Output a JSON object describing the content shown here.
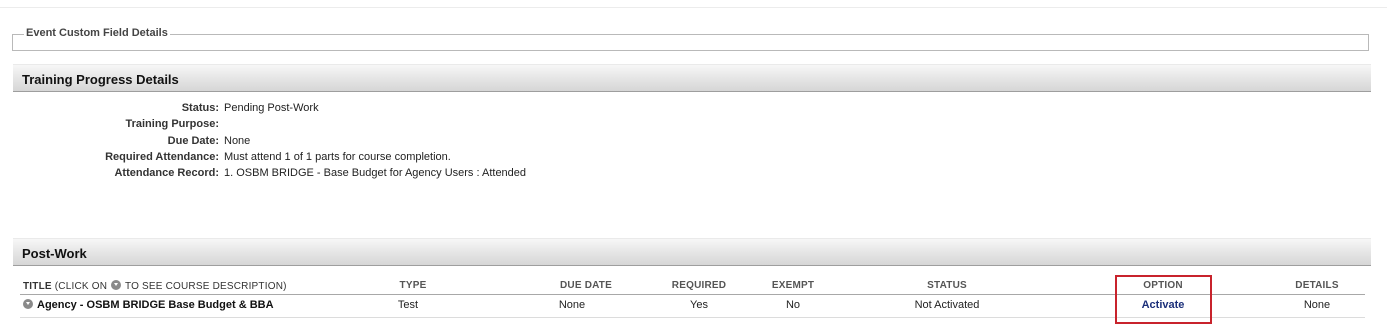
{
  "event_fields": {
    "legend": "Event Custom Field Details"
  },
  "training_progress": {
    "header": "Training Progress Details",
    "rows": [
      {
        "label": "Status:",
        "value": "Pending Post-Work"
      },
      {
        "label": "Training Purpose:",
        "value": ""
      },
      {
        "label": "Due Date:",
        "value": "None"
      },
      {
        "label": "Required Attendance:",
        "value": "Must attend 1 of 1 parts for course completion."
      },
      {
        "label": "Attendance Record:",
        "value": "1. OSBM BRIDGE - Base Budget for Agency Users : Attended"
      }
    ]
  },
  "post_work": {
    "header": "Post-Work",
    "columns": {
      "title_prefix": "TITLE",
      "title_hint_before": "(CLICK ON",
      "title_hint_after": "TO SEE COURSE DESCRIPTION)",
      "type": "TYPE",
      "due_date": "DUE DATE",
      "required": "REQUIRED",
      "exempt": "EXEMPT",
      "status": "STATUS",
      "option": "OPTION",
      "details": "DETAILS"
    },
    "rows": [
      {
        "title": "Agency - OSBM BRIDGE Base Budget & BBA",
        "type": "Test",
        "due_date": "None",
        "required": "Yes",
        "exempt": "No",
        "status": "Not Activated",
        "option": "Activate",
        "details": "None"
      }
    ]
  },
  "icons": {
    "info": "expand-circle-icon"
  },
  "colors": {
    "highlight_border": "#c8232c",
    "link": "#1b2f7a"
  }
}
